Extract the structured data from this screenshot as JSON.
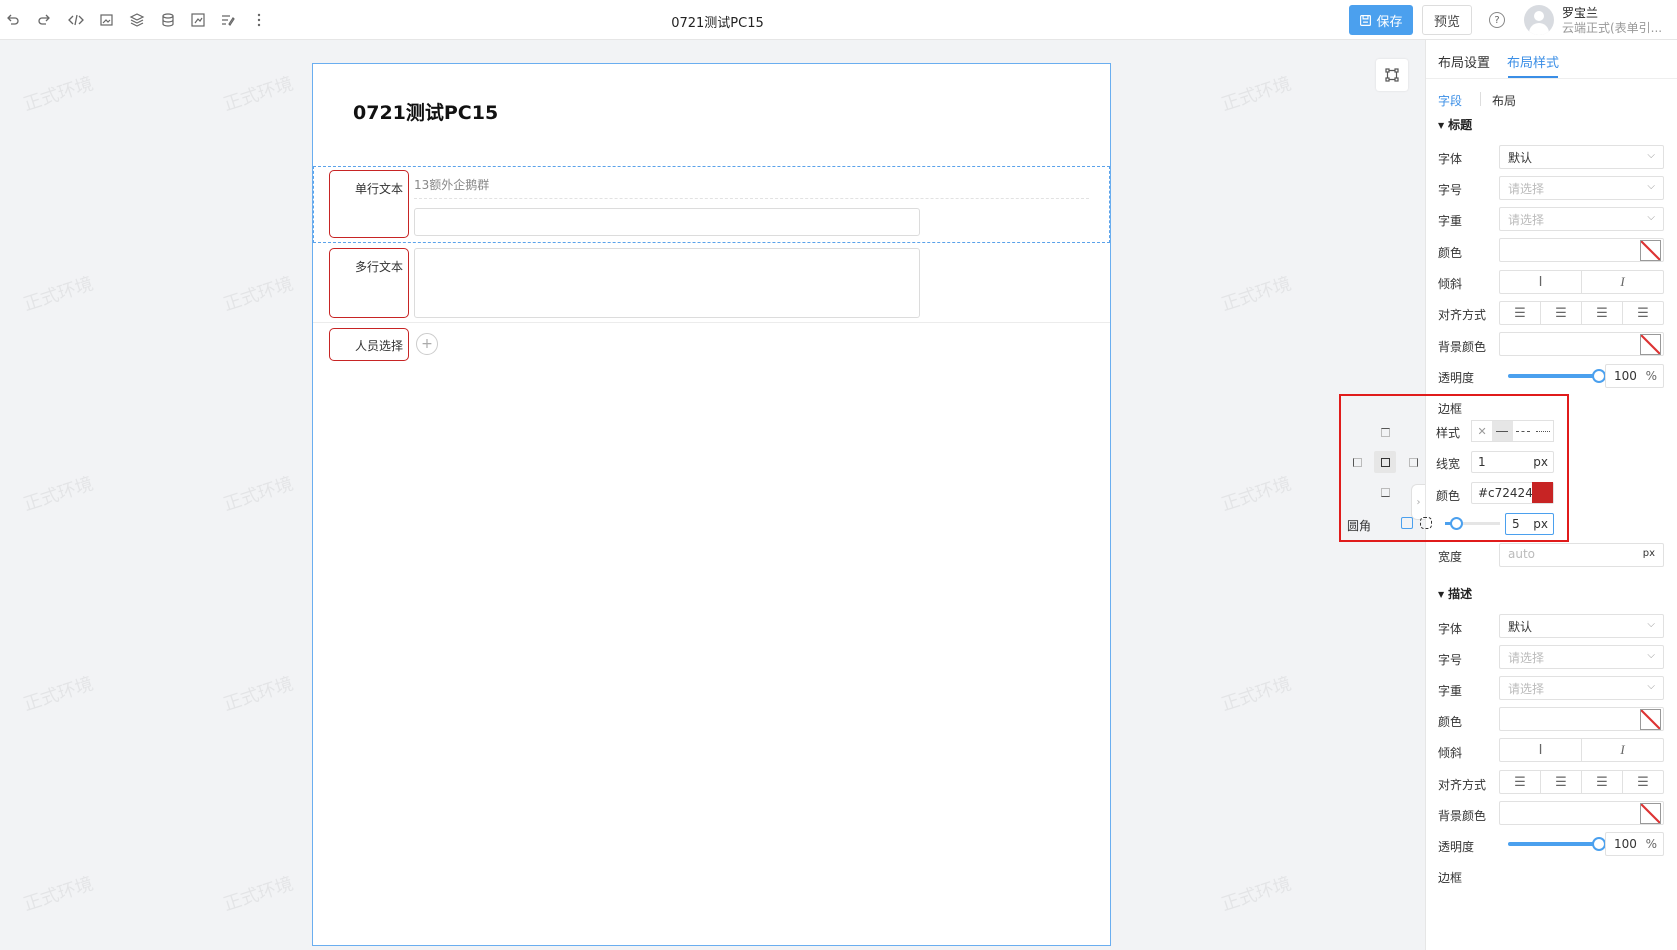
{
  "topbar": {
    "doc_title": "0721测试PC15",
    "save_label": "保存",
    "preview_label": "预览",
    "help_label": "?",
    "user_name": "罗宝兰",
    "user_org": "云端正式(表单引..."
  },
  "watermark": "正式环境",
  "form": {
    "title": "0721测试PC15",
    "fields": [
      {
        "label": "单行文本",
        "description": "13额外企鹅群"
      },
      {
        "label": "多行文本"
      },
      {
        "label": "人员选择",
        "add_symbol": "+"
      }
    ]
  },
  "panel": {
    "tabs": [
      "布局设置",
      "布局样式"
    ],
    "active_tab": "布局样式",
    "subtabs": [
      "字段",
      "布局"
    ],
    "title_section": {
      "heading": "标题",
      "font_label": "字体",
      "font_value": "默认",
      "size_label": "字号",
      "size_placeholder": "请选择",
      "weight_label": "字重",
      "weight_placeholder": "请选择",
      "color_label": "颜色",
      "italic_label": "倾斜",
      "align_label": "对齐方式",
      "bg_label": "背景颜色",
      "opacity_label": "透明度",
      "opacity_value": "100",
      "opacity_unit": "%",
      "opacity": 1.0,
      "border_label": "边框",
      "border_style_label": "样式",
      "border_width_label": "线宽",
      "border_width_value": "1",
      "border_width_unit": "px",
      "border_color_label": "颜色",
      "border_color_value": "#c72424",
      "radius_label": "圆角",
      "radius_value": "5",
      "radius_unit": "px",
      "width_label": "宽度",
      "width_placeholder": "auto",
      "width_unit": "px"
    },
    "desc_section": {
      "heading": "描述",
      "font_label": "字体",
      "font_value": "默认",
      "size_label": "字号",
      "size_placeholder": "请选择",
      "weight_label": "字重",
      "weight_placeholder": "请选择",
      "color_label": "颜色",
      "italic_label": "倾斜",
      "align_label": "对齐方式",
      "bg_label": "背景颜色",
      "opacity_label": "透明度",
      "opacity_value": "100",
      "opacity_unit": "%",
      "opacity": 1.0,
      "border_label": "边框"
    }
  },
  "colors": {
    "accent": "#4ba0ee",
    "label_border": "#c72424",
    "highlight_box": "#e01b1b"
  }
}
